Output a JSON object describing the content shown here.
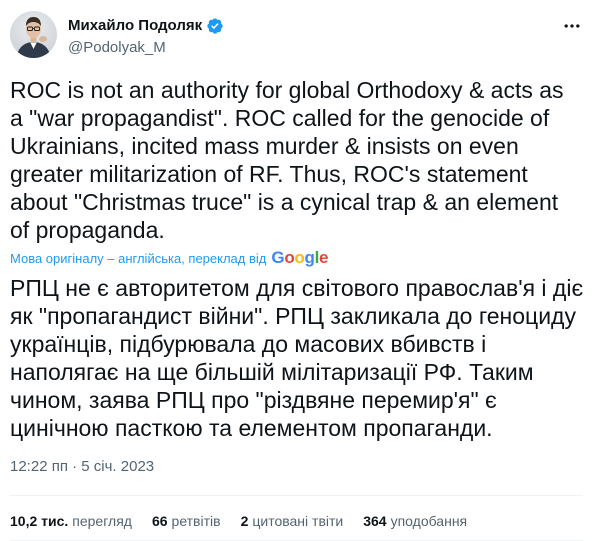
{
  "author": {
    "name": "Михайло Подоляк",
    "handle": "@Podolyak_M",
    "verified_color": "#1d9bf0"
  },
  "tweet": {
    "original_text": "ROC is not an authority for global Orthodoxy & acts as\na \"war propagandist\". ROC called for the genocide of\nUkrainians, incited mass murder & insists on even\ngreater militarization of RF. Thus, ROC's statement\nabout \"Christmas truce\" is a cynical trap & an element\nof propaganda.",
    "translation_note": "Мова оригіналу – англійська, переклад від",
    "translation_provider": "Google",
    "translated_text": "РПЦ не є авторитетом для світового православ'я і діє\nяк \"пропагандист війни\". РПЦ закликала до геноциду\nукраїнців, підбурювала до масових вбивств і\nнаполягає на ще більшій мілітаризації РФ. Таким\nчином, заява РПЦ про \"різдвяне перемир'я\" є\nцинічною пасткою та елементом пропаганди.",
    "timestamp": "12:22 пп · 5 січ. 2023"
  },
  "stats": {
    "views_count": "10,2 тис.",
    "views_label": "перегляд",
    "retweets_count": "66",
    "retweets_label": "ретвітів",
    "quotes_count": "2",
    "quotes_label": "цитовані твіти",
    "likes_count": "364",
    "likes_label": "уподобання"
  },
  "icons": {
    "verified": "verified-badge-icon",
    "more": "more-options-icon"
  }
}
